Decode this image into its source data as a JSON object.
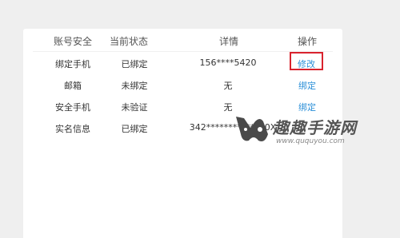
{
  "table": {
    "headers": [
      "账号安全",
      "当前状态",
      "详情",
      "操作"
    ],
    "rows": [
      {
        "item": "绑定手机",
        "status": "已绑定",
        "detail": "156****5420",
        "action": "修改"
      },
      {
        "item": "邮箱",
        "status": "未绑定",
        "detail": "无",
        "action": "绑定"
      },
      {
        "item": "安全手机",
        "status": "未验证",
        "detail": "无",
        "action": "绑定"
      },
      {
        "item": "实名信息",
        "status": "已绑定",
        "detail": "342************50X",
        "action": ""
      }
    ]
  },
  "watermark": {
    "name": "趣趣手游网",
    "url": "www.ququyou.com"
  },
  "colors": {
    "action_link": "#2b8fd8",
    "highlight_border": "#d9232e",
    "page_background": "#efefef",
    "panel_background": "#ffffff"
  }
}
